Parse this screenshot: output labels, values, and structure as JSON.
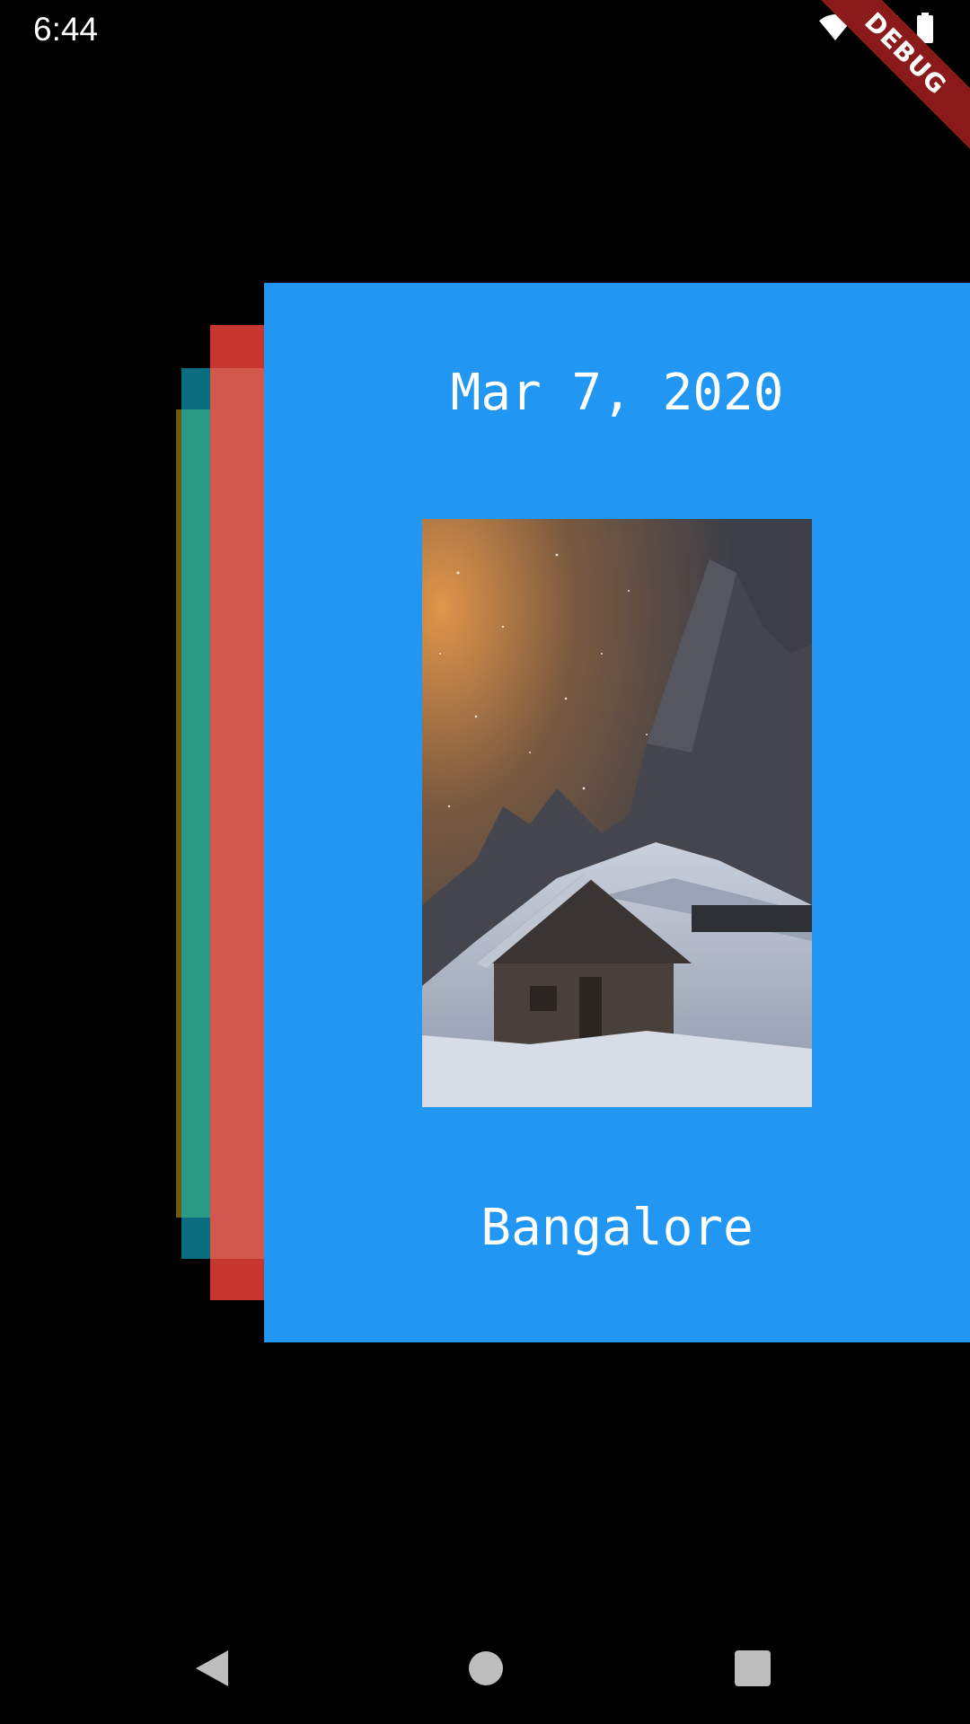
{
  "status_bar": {
    "time": "6:44",
    "icons": [
      "wifi-icon",
      "signal-icon",
      "battery-icon"
    ]
  },
  "debug_banner": {
    "label": "DEBUG"
  },
  "card": {
    "date": "Mar 7, 2020",
    "city": "Bangalore",
    "image": "snowy-mountain-cabin-night"
  },
  "colors": {
    "main_card": "#2196f3",
    "red_card": "#c8372f",
    "teal_card": "#0a6d80",
    "olive_card": "#6b5a10"
  },
  "nav_bar": {
    "icons": [
      "back-icon",
      "home-icon",
      "recents-icon"
    ]
  }
}
